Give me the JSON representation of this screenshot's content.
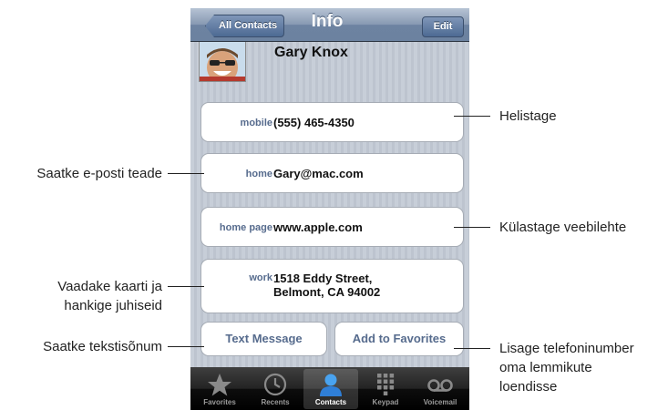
{
  "navbar": {
    "back_label": "All Contacts",
    "title": "Info",
    "edit_label": "Edit"
  },
  "contact": {
    "name": "Gary Knox"
  },
  "fields": [
    {
      "label": "mobile",
      "value": "(555) 465-4350"
    },
    {
      "label": "home",
      "value": "Gary@mac.com"
    },
    {
      "label": "home page",
      "value": "www.apple.com"
    },
    {
      "label": "work",
      "value": "1518 Eddy Street,\nBelmont, CA 94002"
    }
  ],
  "actions": {
    "text_message": "Text Message",
    "add_favorites": "Add to Favorites"
  },
  "tabbar": {
    "items": [
      {
        "label": "Favorites",
        "icon": "star-icon"
      },
      {
        "label": "Recents",
        "icon": "clock-icon"
      },
      {
        "label": "Contacts",
        "icon": "person-icon"
      },
      {
        "label": "Keypad",
        "icon": "keypad-icon"
      },
      {
        "label": "Voicemail",
        "icon": "voicemail-icon"
      }
    ],
    "selected": "Contacts"
  },
  "callouts": {
    "call": "Helistage",
    "email": "Saatke e-posti teade",
    "web": "Külastage veebilehte",
    "map": "Vaadake kaarti ja\nhankige juhiseid",
    "sms": "Saatke tekstisõnum",
    "favorites": "Lisage telefoninumber\noma lemmikute\nloendisse"
  },
  "colors": {
    "navbar": "#6d83a1",
    "field_label": "#566b8d",
    "tabbar": "#000000",
    "selected_tab_icon": "#3d8fe0"
  }
}
